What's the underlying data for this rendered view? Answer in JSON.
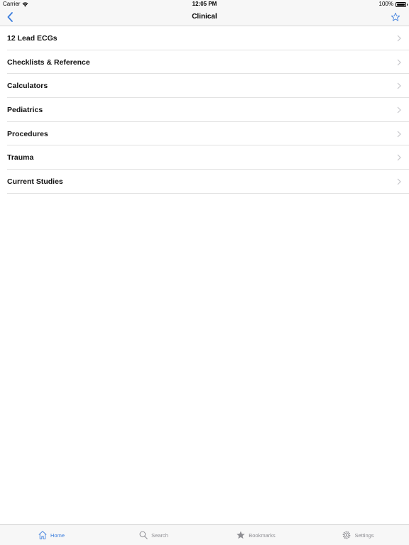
{
  "status_bar": {
    "carrier": "Carrier",
    "time": "12:05 PM",
    "battery": "100%",
    "battery_level": 1.0
  },
  "nav": {
    "title": "Clinical"
  },
  "list": {
    "items": [
      {
        "label": "12 Lead ECGs"
      },
      {
        "label": "Checklists & Reference"
      },
      {
        "label": "Calculators"
      },
      {
        "label": "Pediatrics"
      },
      {
        "label": "Procedures"
      },
      {
        "label": "Trauma"
      },
      {
        "label": "Current Studies"
      }
    ]
  },
  "tabs": {
    "home": "Home",
    "search": "Search",
    "bookmarks": "Bookmarks",
    "settings": "Settings"
  },
  "colors": {
    "accent": "#3b7ddd",
    "inactive": "#8e8e93",
    "bar_background": "#f7f7f7"
  },
  "icons": [
    "wifi-icon",
    "battery-icon",
    "back-chevron-icon",
    "star-outline-icon",
    "chevron-right-icon",
    "home-icon",
    "search-icon",
    "star-filled-icon",
    "gear-icon"
  ]
}
